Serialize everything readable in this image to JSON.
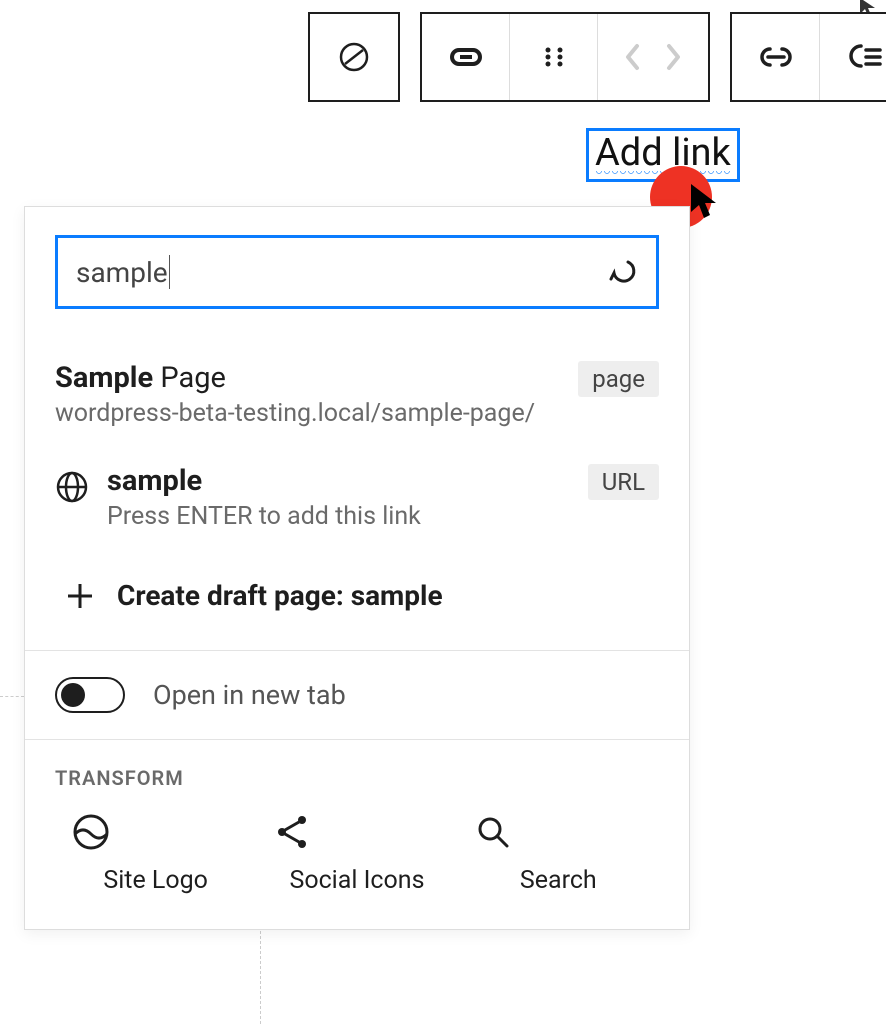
{
  "block": {
    "selected_label": "Add link"
  },
  "link_popover": {
    "search_value": "sample",
    "results": [
      {
        "title_match": "Sample",
        "title_rest": " Page",
        "url": "wordpress-beta-testing.local/sample-page/",
        "type_badge": "page"
      },
      {
        "title_match": "sample",
        "title_rest": "",
        "hint": "Press ENTER to add this link",
        "type_badge": "URL"
      }
    ],
    "create_draft_prefix": "Create draft page: ",
    "create_draft_value": "sample",
    "open_new_tab_label": "Open in new tab",
    "open_new_tab_on": false
  },
  "transform": {
    "heading": "TRANSFORM",
    "items": [
      {
        "label": "Site Logo"
      },
      {
        "label": "Social Icons"
      },
      {
        "label": "Search"
      }
    ]
  }
}
